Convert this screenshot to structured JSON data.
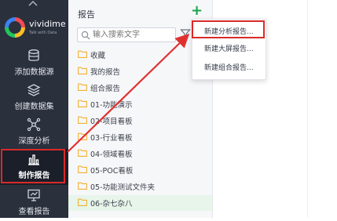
{
  "app": {
    "logo_name": "vividime",
    "logo_tagline": "Talk with Data"
  },
  "sidebar": {
    "items": [
      {
        "label": "添加数据源",
        "icon": "database-add-icon"
      },
      {
        "label": "创建数据集",
        "icon": "dataset-icon"
      },
      {
        "label": "深度分析",
        "icon": "deep-analysis-icon"
      },
      {
        "label": "制作报告",
        "icon": "report-chart-icon",
        "active": true
      },
      {
        "label": "查看报告",
        "icon": "view-report-icon"
      }
    ]
  },
  "panel": {
    "title": "报告",
    "add_symbol": "+",
    "search_placeholder": "输入搜索文字",
    "tree": [
      {
        "label": "收藏"
      },
      {
        "label": "我的报告"
      },
      {
        "label": "组合报告"
      },
      {
        "label": "01-功能演示"
      },
      {
        "label": "02-项目看板"
      },
      {
        "label": "03-行业看板"
      },
      {
        "label": "04-领域看板"
      },
      {
        "label": "05-POC看板"
      },
      {
        "label": "05-功能测试文件夹"
      },
      {
        "label": "06-杂七杂八",
        "selected": true
      }
    ]
  },
  "menu": {
    "items": [
      {
        "label": "新建分析报告..."
      },
      {
        "label": "新建大屏报告..."
      },
      {
        "label": "新建组合报告..."
      }
    ]
  },
  "colors": {
    "sidebar_bg": "#2b303d",
    "accent_green": "#19a34a",
    "highlight_red": "#d92a2a",
    "folder_orange": "#f2b233"
  }
}
